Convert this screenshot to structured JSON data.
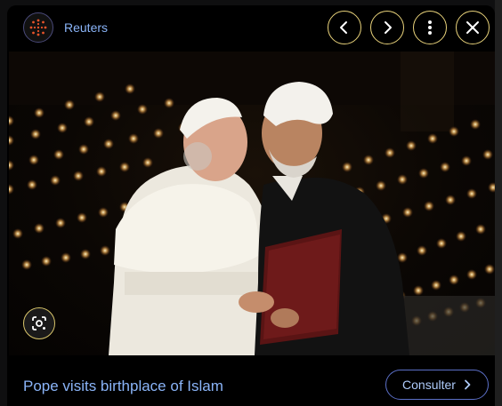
{
  "header": {
    "source_name": "Reuters",
    "source_logo_icon": "reuters-logo-icon",
    "accent_color": "#8ab4f8"
  },
  "toolbar": {
    "prev_icon": "chevron-left-icon",
    "next_icon": "chevron-right-icon",
    "more_icon": "more-vert-icon",
    "close_icon": "close-icon",
    "button_border_color": "#e8d27a"
  },
  "image": {
    "lens_icon": "google-lens-icon"
  },
  "footer": {
    "headline": "Pope visits birthplace of Islam",
    "visit_button_label": "Consulter",
    "visit_button_icon": "chevron-right-icon"
  }
}
